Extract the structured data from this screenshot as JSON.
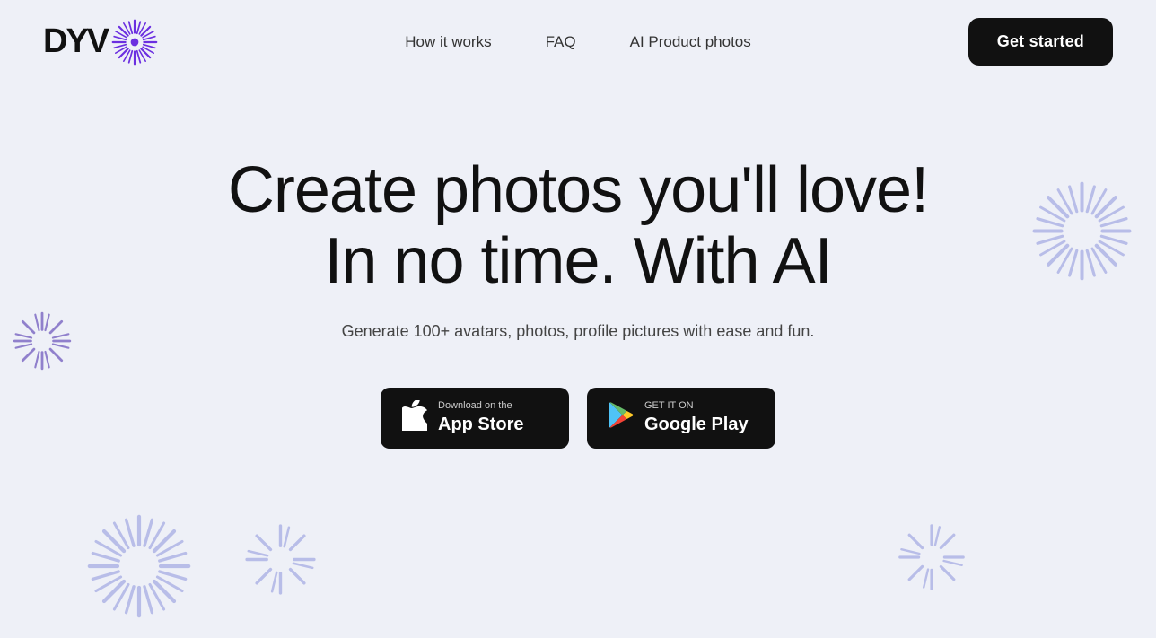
{
  "logo": {
    "text": "DYV",
    "icon_color": "#6B2FE0"
  },
  "nav": {
    "links": [
      {
        "label": "How it works",
        "href": "#"
      },
      {
        "label": "FAQ",
        "href": "#"
      },
      {
        "label": "AI Product photos",
        "href": "#"
      }
    ],
    "cta_label": "Get started"
  },
  "hero": {
    "title_line1": "Create photos you'll love!",
    "title_line2": "In no time. With AI",
    "subtitle": "Generate 100+ avatars, photos, profile pictures with ease and fun."
  },
  "store_buttons": {
    "app_store": {
      "small_text": "Download on the",
      "large_text": "App Store"
    },
    "google_play": {
      "small_text": "GET IT ON",
      "large_text": "Google Play"
    }
  }
}
